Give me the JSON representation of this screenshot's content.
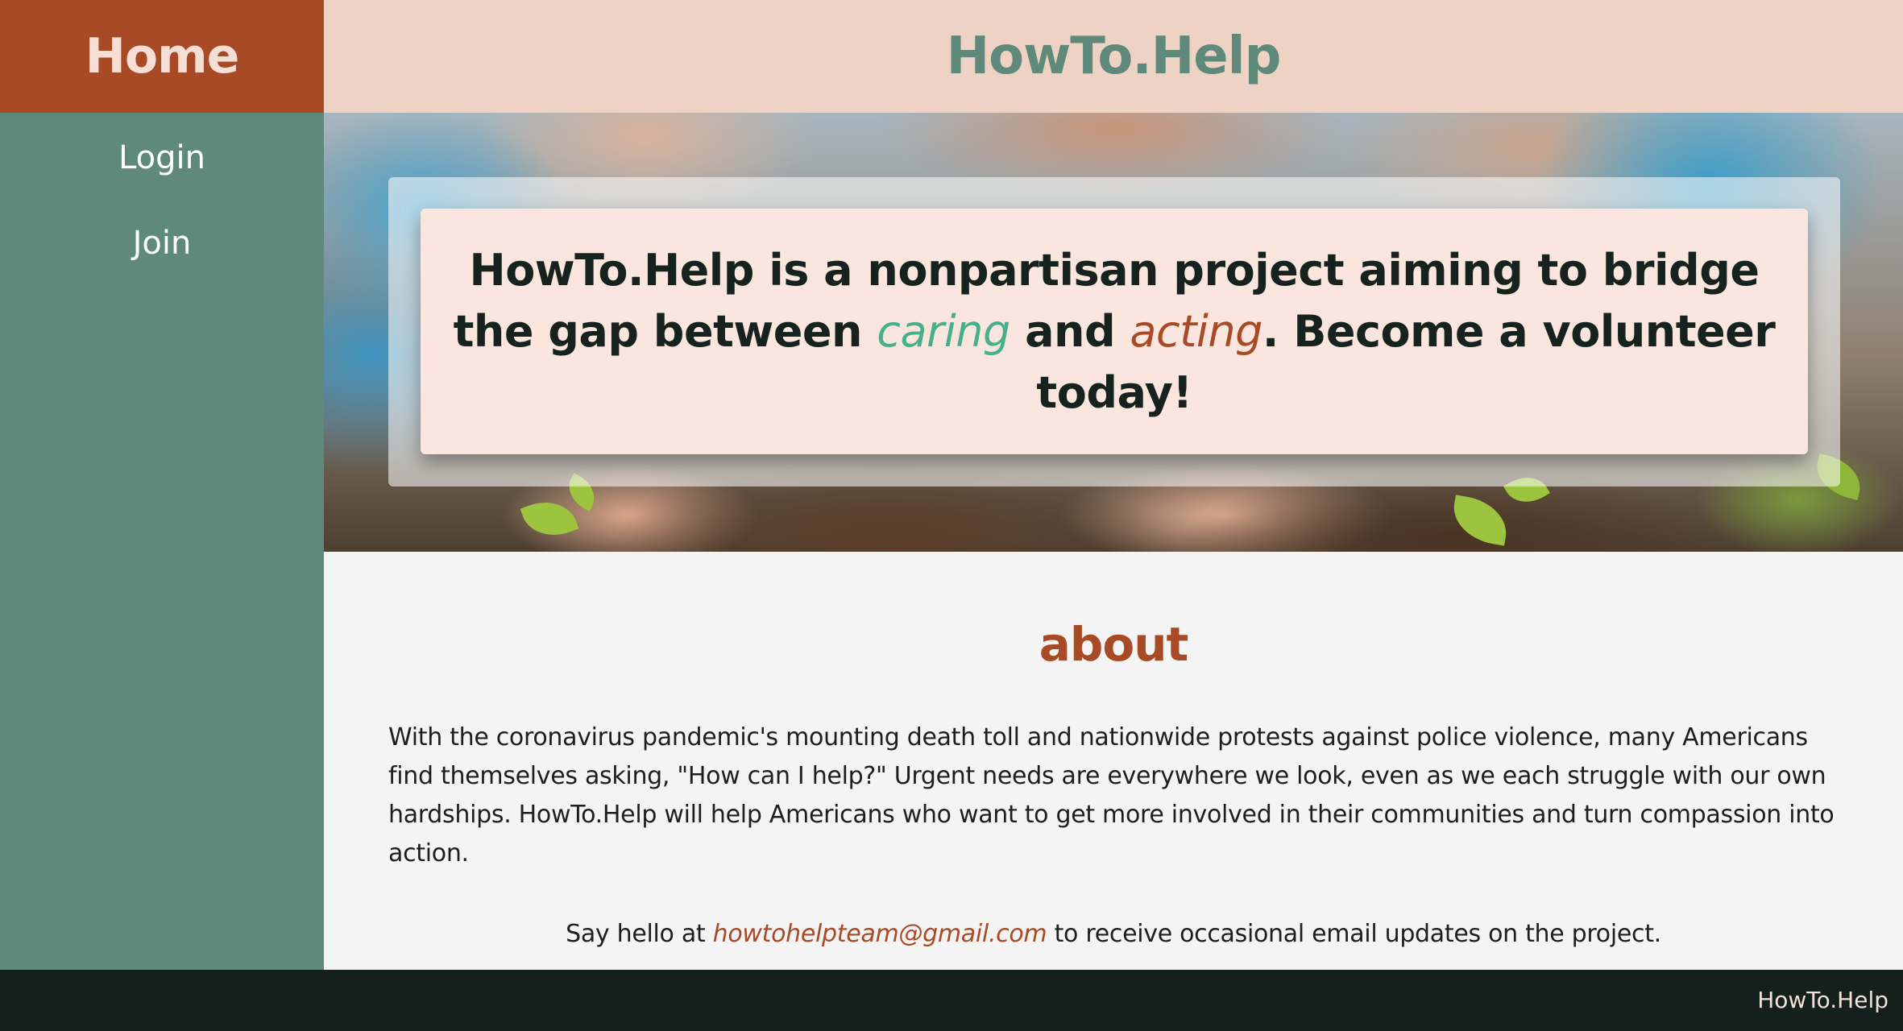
{
  "sidebar": {
    "home_label": "Home",
    "items": [
      {
        "label": "Login"
      },
      {
        "label": "Join"
      }
    ]
  },
  "header": {
    "title": "HowTo.Help"
  },
  "hero": {
    "text_before": "HowTo.Help is a nonpartisan project aiming to bridge the gap between ",
    "emphasis_1": "caring",
    "text_middle": " and ",
    "emphasis_2": "acting",
    "text_after": ". Become a volunteer today!"
  },
  "about": {
    "heading": "about",
    "body": "With the coronavirus pandemic's mounting death toll and nationwide protests against police violence, many Americans find themselves asking, \"How can I help?\" Urgent needs are everywhere we look, even as we each struggle with our own hardships. HowTo.Help will help Americans who want to get more involved in their communities and turn compassion into action.",
    "contact_before": "Say hello at ",
    "email": "howtohelpteam@gmail.com",
    "contact_after": " to receive occasional email updates on the project."
  },
  "footer": {
    "text": "HowTo.Help"
  },
  "colors": {
    "brand_rust": "#a84a25",
    "brand_green": "#5f8a7b",
    "accent_teal": "#45b18a",
    "header_bg": "#eed3c5",
    "card_bg": "#fae6de",
    "footer_bg": "#14201c"
  }
}
